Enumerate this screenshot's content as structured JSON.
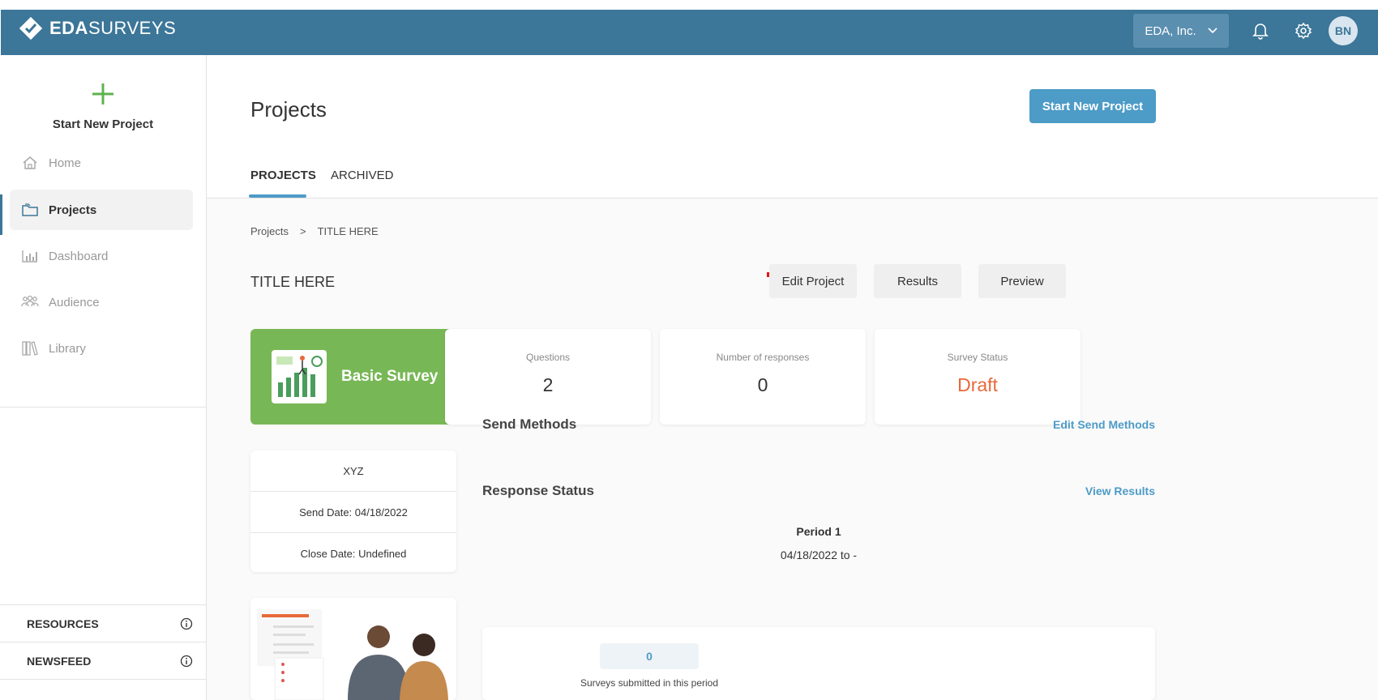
{
  "app": {
    "brand_bold": "EDA",
    "brand_rest": "SURVEYS",
    "org": "EDA, Inc.",
    "avatar": "BN"
  },
  "sidebar": {
    "start_new": "Start New Project",
    "items": [
      {
        "label": "Home",
        "icon": "home-icon"
      },
      {
        "label": "Projects",
        "icon": "folder-icon",
        "active": true
      },
      {
        "label": "Dashboard",
        "icon": "bar-chart-icon"
      },
      {
        "label": "Audience",
        "icon": "people-icon"
      },
      {
        "label": "Library",
        "icon": "books-icon"
      }
    ],
    "resources": "RESOURCES",
    "newsfeed": "NEWSFEED"
  },
  "main": {
    "title": "Projects",
    "start_button": "Start New Project",
    "tabs": [
      {
        "label": "PROJECTS"
      },
      {
        "label": "ARCHIVED"
      }
    ],
    "breadcrumb": {
      "root": "Projects",
      "sep": ">",
      "current": "TITLE HERE"
    },
    "project_title": "TITLE HERE",
    "actions": {
      "edit": "Edit Project",
      "results": "Results",
      "preview": "Preview"
    },
    "survey_type": "Basic Survey",
    "stats": {
      "questions_label": "Questions",
      "questions_value": "2",
      "responses_label": "Number of responses",
      "responses_value": "0",
      "status_label": "Survey Status",
      "status_value": "Draft"
    },
    "info": {
      "name": "XYZ",
      "send_date": "Send Date: 04/18/2022",
      "close_date": "Close Date: Undefined"
    },
    "send_methods": {
      "title": "Send Methods",
      "link": "Edit Send Methods"
    },
    "response_status": {
      "title": "Response Status",
      "link": "View Results"
    },
    "period": {
      "name": "Period 1",
      "range": "04/18/2022 to -"
    },
    "submitted": {
      "value": "0",
      "label": "Surveys submitted in this period"
    }
  },
  "colors": {
    "topbar": "#3c7699",
    "accent": "#4d9bc7",
    "survey_card": "#78b756",
    "draft": "#e8693b",
    "plus": "#5fb24e",
    "arrow": "#e8150f"
  }
}
